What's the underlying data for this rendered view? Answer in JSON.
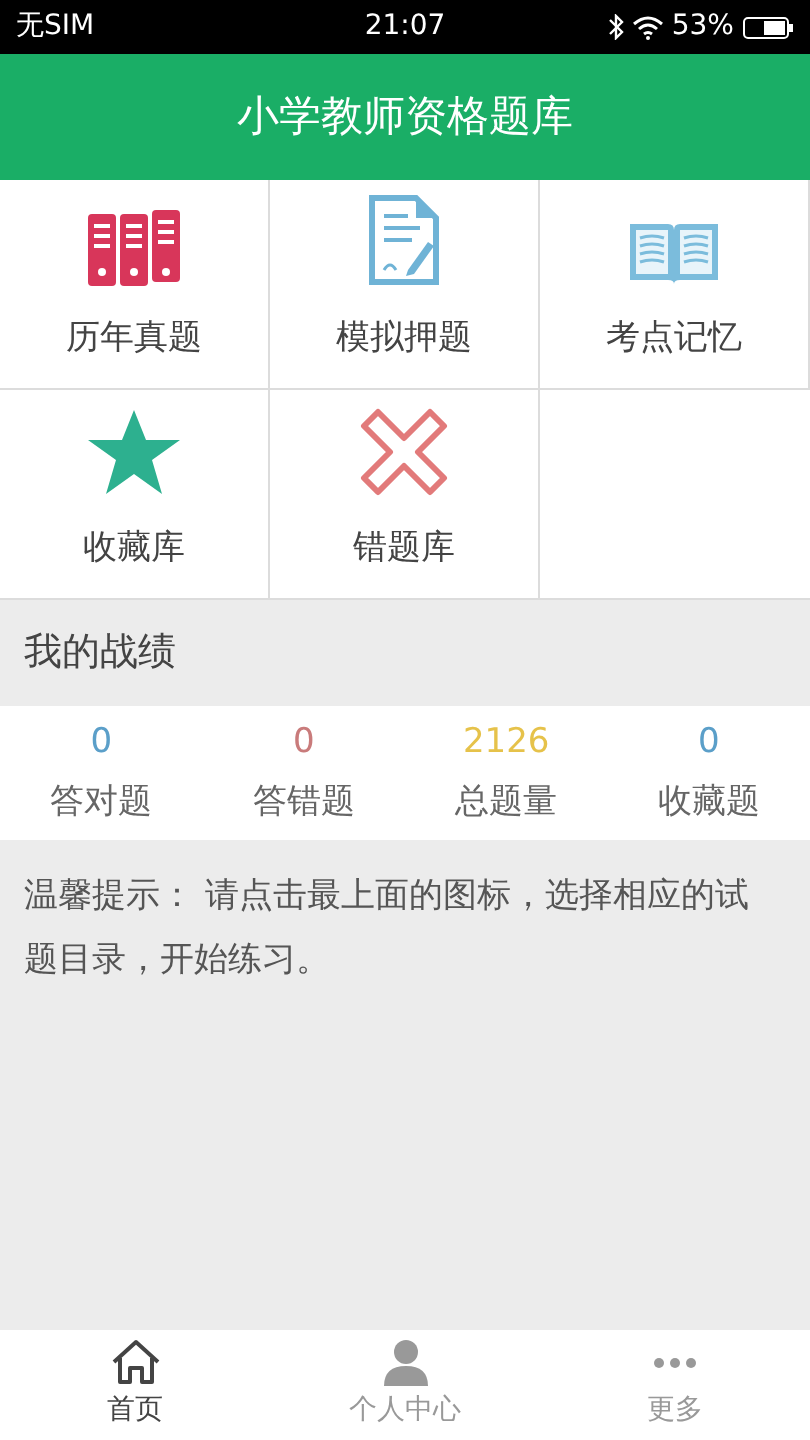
{
  "status_bar": {
    "carrier": "无SIM",
    "time": "21:07",
    "battery": "53%"
  },
  "header": {
    "title": "小学教师资格题库"
  },
  "menu": [
    {
      "kind": "binders",
      "label": "历年真题"
    },
    {
      "kind": "document",
      "label": "模拟押题"
    },
    {
      "kind": "book",
      "label": "考点记忆"
    },
    {
      "kind": "star",
      "label": "收藏库"
    },
    {
      "kind": "cross",
      "label": "错题库"
    }
  ],
  "section_title": "我的战绩",
  "stats": [
    {
      "value": "0",
      "label": "答对题",
      "color": "#5b9fc9"
    },
    {
      "value": "0",
      "label": "答错题",
      "color": "#c97b7b"
    },
    {
      "value": "2126",
      "label": "总题量",
      "color": "#e6c24a"
    },
    {
      "value": "0",
      "label": "收藏题",
      "color": "#5b9fc9"
    }
  ],
  "tip": "温馨提示： 请点击最上面的图标，选择相应的试题目录，开始练习。",
  "tab_bar": [
    {
      "kind": "home",
      "label": "首页",
      "selected": true
    },
    {
      "kind": "person",
      "label": "个人中心",
      "selected": false
    },
    {
      "kind": "more",
      "label": "更多",
      "selected": false
    }
  ]
}
